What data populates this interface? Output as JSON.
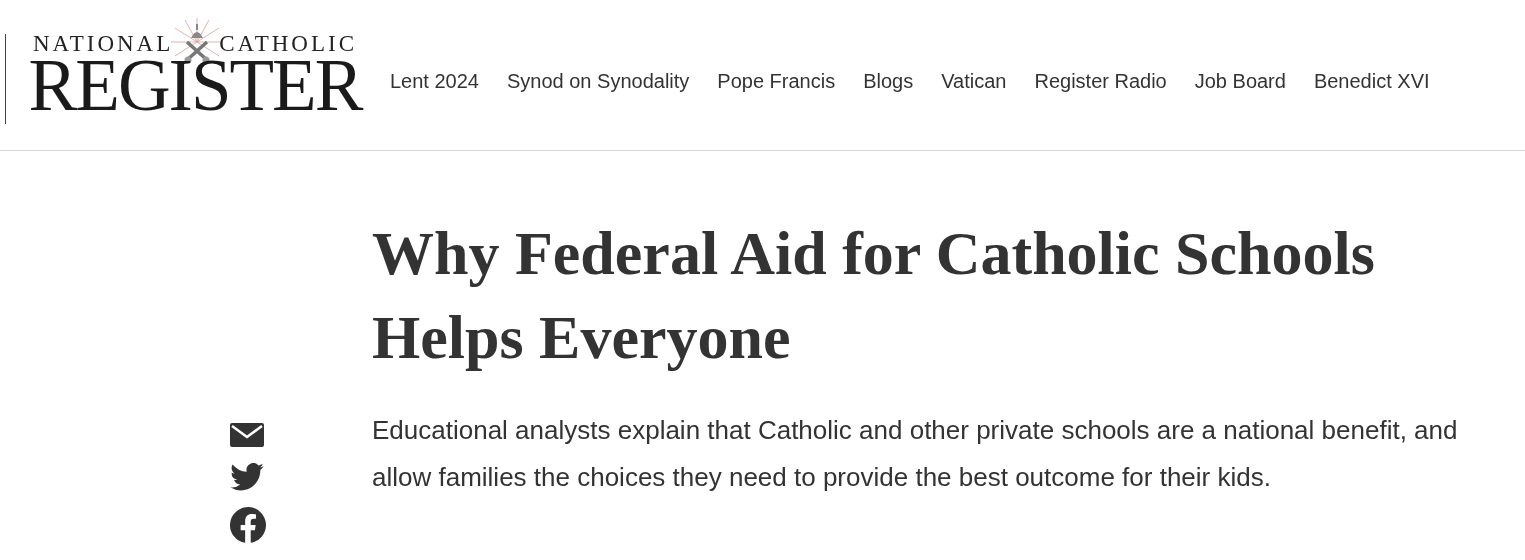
{
  "logo": {
    "top_left": "NATIONAL",
    "top_right": "CATHOLIC",
    "main": "REGISTER"
  },
  "nav": [
    "Lent 2024",
    "Synod on Synodality",
    "Pope Francis",
    "Blogs",
    "Vatican",
    "Register Radio",
    "Job Board",
    "Benedict XVI"
  ],
  "share": [
    {
      "kind": "email"
    },
    {
      "kind": "twitter"
    },
    {
      "kind": "facebook"
    }
  ],
  "article": {
    "title": "Why Federal Aid for Catholic Schools Helps Everyone",
    "summary": "Educational analysts explain that Catholic and other private schools are a national benefit, and allow families the choices they need to provide the best outcome for their kids."
  }
}
